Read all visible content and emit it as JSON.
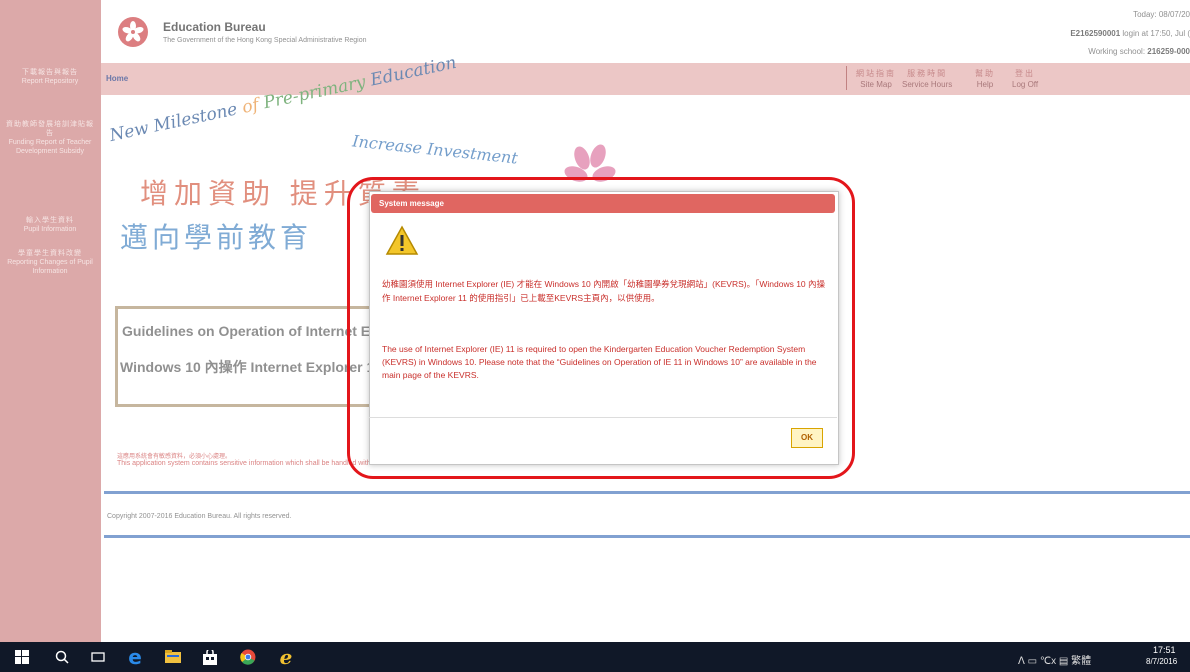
{
  "sidebar": {
    "items": [
      {
        "zh": "下載報告與報告",
        "en": "Report Repository"
      },
      {
        "zh": "資助教師發展培訓津貼報告",
        "en": "Funding Report of Teacher Development Subsidy"
      },
      {
        "zh": "輸入學生資料",
        "en": "Pupil Information"
      },
      {
        "zh": "學童學生資料改變",
        "en": "Reporting Changes of Pupil Information"
      }
    ]
  },
  "header": {
    "title": "Education Bureau",
    "subtitle": "The Government of the Hong Kong Special Administrative Region",
    "today": "Today: 08/07/20",
    "login_id": "E2162590001",
    "login_rest": " login at 17:50, Jul (",
    "school_label": "Working school: ",
    "school_code": "216259-000"
  },
  "nav": {
    "home": "Home",
    "links": [
      {
        "zh": "網站指南",
        "en": "Site Map"
      },
      {
        "zh": "服務時間",
        "en": "Service Hours"
      },
      {
        "zh": "幫助",
        "en": "Help"
      },
      {
        "zh": "登出",
        "en": "Log Off"
      }
    ]
  },
  "banner": {
    "en_a": "New Milestone",
    "en_b": " of ",
    "en_c": "Pre-primary",
    "en_d": " Education",
    "en2": "Increase Investment",
    "zh1": "增加資助  提升質素",
    "zh2": "邁向學前教育"
  },
  "guide": {
    "line1": "Guidelines on Operation of Internet Explorer 11",
    "line2": "Windows 10 內操作 Internet Explorer 11"
  },
  "notice": {
    "zh": "這應用系統會有敏感資料，必須小心處理。",
    "en": "This application system contains sensitive information which shall be handled with care."
  },
  "footer": {
    "copyright": "Copyright 2007-2016 Education Bureau. All rights reserved."
  },
  "dialog": {
    "title": "System message",
    "message_zh": "幼稚園須使用 Internet Explorer (IE) 才能在 Windows 10 內開啟「幼稚園學券兌現網站」(KEVRS)。「Windows 10 內操作 Internet Explorer 11 的使用指引」已上載至KEVRS主頁內，以供使用。",
    "message_en": "The use of Internet Explorer (IE) 11 is required to open the Kindergarten Education Voucher Redemption System (KEVRS) in Windows 10. Please note that the “Guidelines on Operation of IE 11 in Windows 10” are available in the main page of the KEVRS.",
    "ok_label": "OK"
  },
  "taskbar": {
    "tray": "ᐱ  ▭  ℃x  ▤  繁體",
    "time": "17:51",
    "date": "8/7/2016"
  }
}
